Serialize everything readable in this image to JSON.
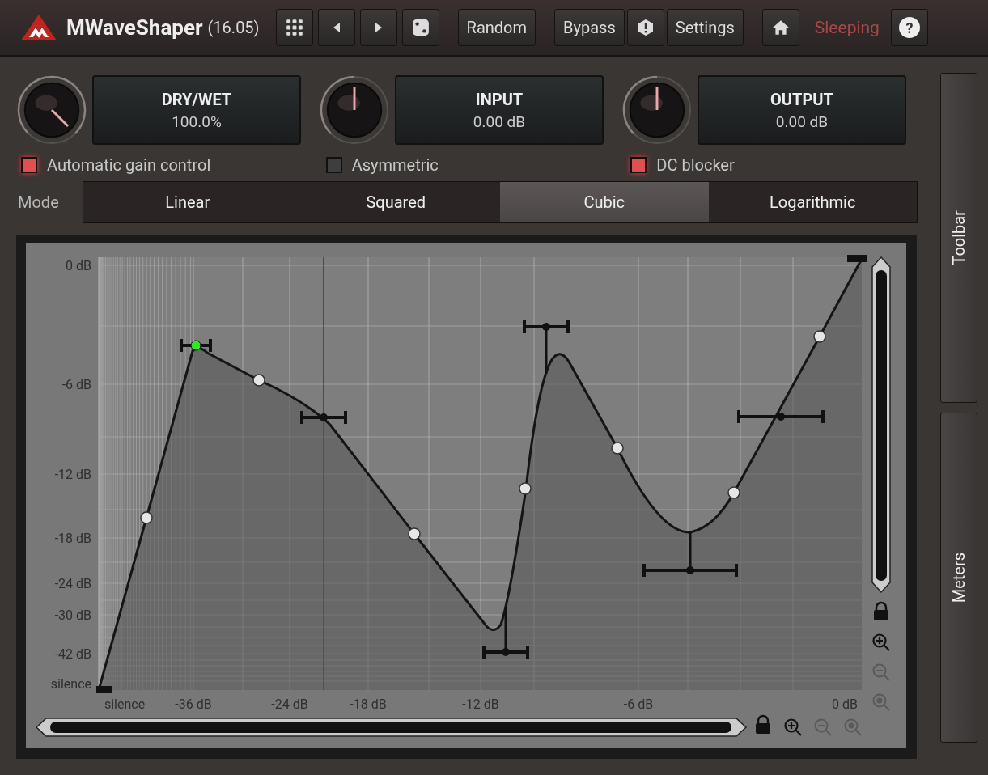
{
  "header": {
    "title": "MWaveShaper",
    "version": "(16.05)",
    "buttons": [
      "Random",
      "Bypass",
      "Settings"
    ],
    "status": "Sleeping",
    "help": "?"
  },
  "knobs": [
    {
      "label": "DRY/WET",
      "value": "100.0%",
      "level": 1
    },
    {
      "label": "INPUT",
      "value": "0.00 dB",
      "level": 0.5
    },
    {
      "label": "OUTPUT",
      "value": "0.00 dB",
      "level": 0.5
    }
  ],
  "toggles": [
    {
      "label": "Automatic gain control",
      "checked": true
    },
    {
      "label": "Asymmetric",
      "checked": false
    },
    {
      "label": "DC blocker",
      "checked": true
    }
  ],
  "mode": {
    "label": "Mode",
    "options": [
      {
        "label": "Linear",
        "selected": false
      },
      {
        "label": "Squared",
        "selected": false
      },
      {
        "label": "Cubic",
        "selected": true
      },
      {
        "label": "Logarithmic",
        "selected": false
      }
    ]
  },
  "graph": {
    "y_labels": [
      "0 dB",
      "-6 dB",
      "-12 dB",
      "-18 dB",
      "-24 dB",
      "-30 dB",
      "-42 dB",
      "silence"
    ],
    "x_labels": [
      "silence",
      "-36 dB",
      "-24 dB",
      "-18 dB",
      "-12 dB",
      "-6 dB",
      "0 dB"
    ]
  },
  "side_buttons": [
    "Toolbar",
    "Meters"
  ]
}
